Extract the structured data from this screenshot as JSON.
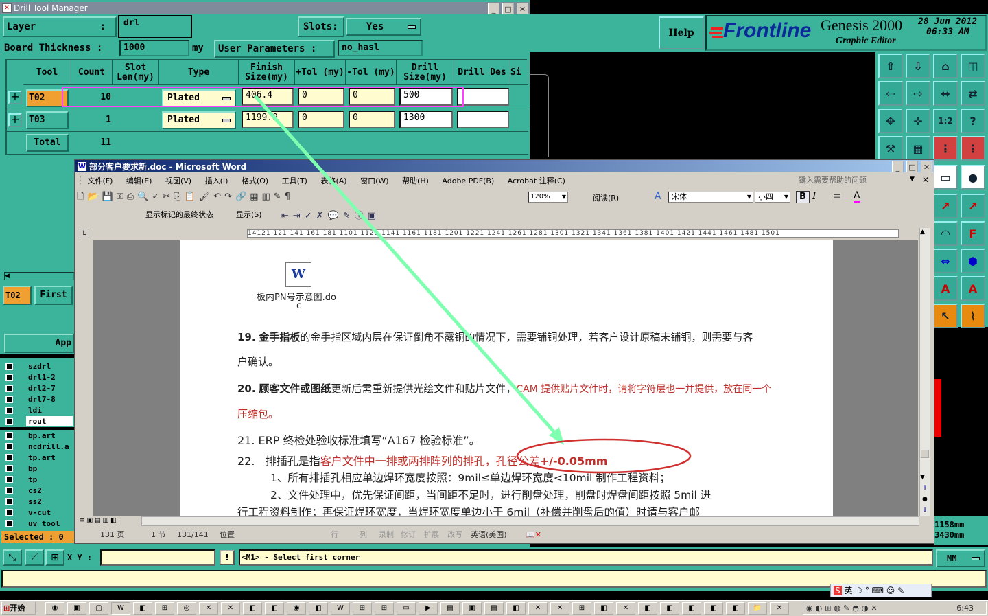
{
  "drill": {
    "title": "Drill Tool Manager",
    "layer_label": "Layer",
    "layer_colon": ":",
    "layer_value": "drl",
    "slots_label": "Slots:",
    "slots_value": "Yes",
    "thickness_label": "Board Thickness :",
    "thickness_value": "1000",
    "thickness_unit": "my",
    "user_params_label": "User Parameters :",
    "user_params_value": "no_hasl",
    "columns": [
      "Tool",
      "Count",
      "Slot Len(my)",
      "Type",
      "Finish Size(my)",
      "+Tol (my)",
      "-Tol (my)",
      "Drill Size(my)",
      "Drill Des",
      "Si"
    ],
    "rows": [
      {
        "tool": "T02",
        "count": "10",
        "type": "Plated",
        "finish": "406.4",
        "ptol": "0",
        "mtol": "0",
        "drill": "500",
        "des": ""
      },
      {
        "tool": "T03",
        "count": "1",
        "type": "Plated",
        "finish": "1199.9",
        "ptol": "0",
        "mtol": "0",
        "drill": "1300",
        "des": ""
      }
    ],
    "total_label": "Total",
    "total_count": "11",
    "current_tool": "T02",
    "first_btn": "First",
    "apply_btn": "App"
  },
  "genesis": {
    "help": "Help",
    "brand": "Frontline",
    "product": "Genesis 2000",
    "subtitle": "Graphic Editor",
    "date": "28 Jun 2012",
    "time": "06:33 AM",
    "coord_x": "1158mm",
    "coord_y": "3430mm",
    "xy_label": "X Y :",
    "status_msg": "<M1> - Select first corner",
    "units": "MM",
    "selected": "Selected : 0"
  },
  "layers": [
    "szdrl",
    "drl1-2",
    "drl2-7",
    "drl7-8",
    "ldi",
    "rout",
    "bp.art",
    "ncdrill.a",
    "tp.art",
    "bp",
    "tp",
    "cs2",
    "ss2",
    "v-cut",
    "uv tool"
  ],
  "word": {
    "title": "部分客户要求新.doc - Microsoft Word",
    "menu": [
      "文件(F)",
      "编辑(E)",
      "视图(V)",
      "插入(I)",
      "格式(O)",
      "工具(T)",
      "表格(A)",
      "窗口(W)",
      "帮助(H)",
      "Adobe PDF(B)",
      "Acrobat 注释(C)"
    ],
    "help_placeholder": "键入需要帮助的问题",
    "zoom": "120%",
    "read_btn": "阅读(R)",
    "font": "宋体",
    "size": "小四",
    "track_view": "显示标记的最终状态",
    "show_btn": "显示(S)",
    "ruler": "14121 121 141 161 181 1101 1121 1141 1161 1181 1201 1221 1241 1261 1281 1301 1321 1341 1361 1381 1401 1421 1441 1461 1481 1501",
    "embed_name": "板内PN号示意图.do",
    "embed_name2": "c",
    "item19_num": "19.",
    "item19_bold": "金手指板",
    "item19_text": "的金手指区域内层在保证倒角不露铜的情况下，需要铺铜处理，若客户设计原稿未铺铜，则需要与客",
    "item19_cont": "户确认。",
    "item20_num": "20.",
    "item20_bold": "顾客文件或图纸",
    "item20_text": "更新后需重新提供光绘文件和贴片文件，",
    "item20_red": "CAM 提供贴片文件时，请将字符层也一并提供，放在同一个",
    "item20_cont": "压缩包。",
    "item21": "21. ERP 终检处验收标准填写“A167 检验标准”。",
    "item22_num": "22.",
    "item22_text": "排插孔是指",
    "item22_red": "客户文件中一排或两排阵列的排孔，孔径公差",
    "item22_tol": "+/-0.05mm",
    "item22_1": "1、所有排插孔相应单边焊环宽度按照：9mil≤单边焊环宽度<10mil 制作工程资料；",
    "item22_2": "2、文件处理中，优先保证间距，当间距不足时，进行削盘处理，削盘时焊盘间距按照 5mil 进",
    "item22_3": "行工程资料制作；再保证焊环宽度，当焊环宽度单边小于 6mil（补偿并削盘后的值）时请与客户邮",
    "status_page": "131 页",
    "status_sec": "1 节",
    "status_pos": "131/141",
    "status_at": "位置",
    "status_line": "行",
    "status_col": "列",
    "status_rec": "录制",
    "status_trk": "修订",
    "status_ext": "扩展",
    "status_ovr": "改写",
    "status_lang": "英语(美国)"
  },
  "taskbar": {
    "start": "开始",
    "clock": "6:43",
    "ime": "英"
  },
  "colors": {
    "teal": "#3cb39b",
    "arrow": "#7fffb0",
    "highlight": "#ff40ff",
    "circle": "#d03030",
    "red_text": "#c0302a"
  }
}
